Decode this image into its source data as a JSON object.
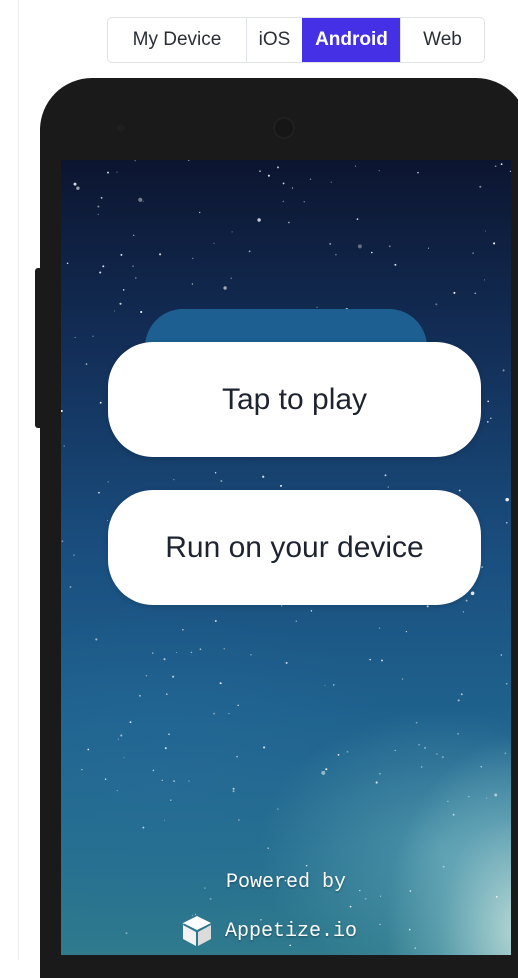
{
  "platform_tabs": [
    {
      "label": "My Device",
      "active": false
    },
    {
      "label": "iOS",
      "active": false
    },
    {
      "label": "Android",
      "active": true
    },
    {
      "label": "Web",
      "active": false
    }
  ],
  "overlay": {
    "play_label": "Tap to play",
    "device_label": "Run on your device"
  },
  "footer": {
    "powered_text": "Powered by",
    "brand_text": "Appetize.io",
    "brand_icon": "cube-icon"
  },
  "colors": {
    "accent": "#4530e6",
    "phone_frame": "#1a1a1a",
    "button_bg": "#ffffff"
  }
}
